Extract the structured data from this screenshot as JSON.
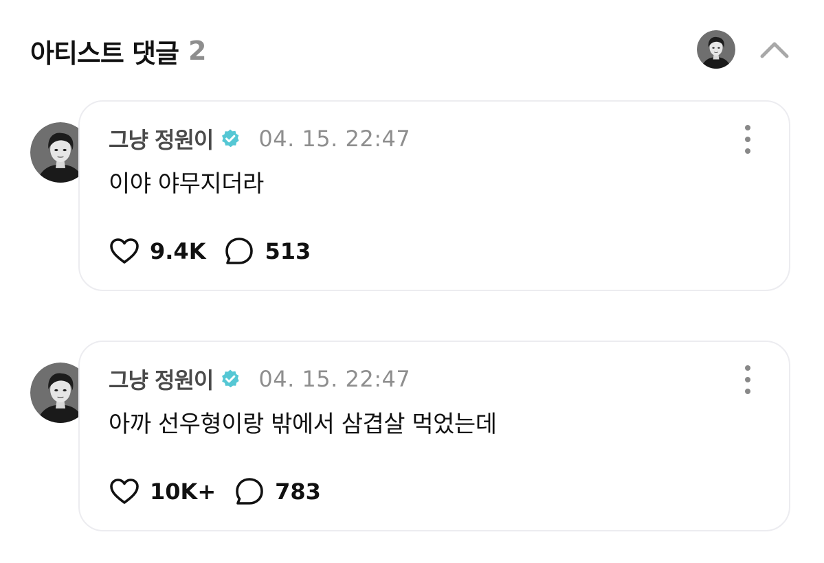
{
  "header": {
    "title": "아티스트 댓글",
    "count": "2"
  },
  "comments": [
    {
      "author": "그냥 정원이",
      "timestamp": "04. 15. 22:47",
      "text": "이야 야무지더라",
      "likes": "9.4K",
      "replies": "513"
    },
    {
      "author": "그냥 정원이",
      "timestamp": "04. 15. 22:47",
      "text": "아까 선우형이랑 밖에서 삼겹살 먹었는데",
      "likes": "10K+",
      "replies": "783"
    }
  ],
  "colors": {
    "verified": "#55c7d4",
    "muted": "#8e8e8e",
    "card_border": "#ececf0"
  },
  "icons": {
    "verified": "verified-badge-icon",
    "like": "heart-icon",
    "reply": "speech-bubble-icon",
    "more": "more-vertical-icon",
    "collapse": "chevron-up-icon"
  }
}
